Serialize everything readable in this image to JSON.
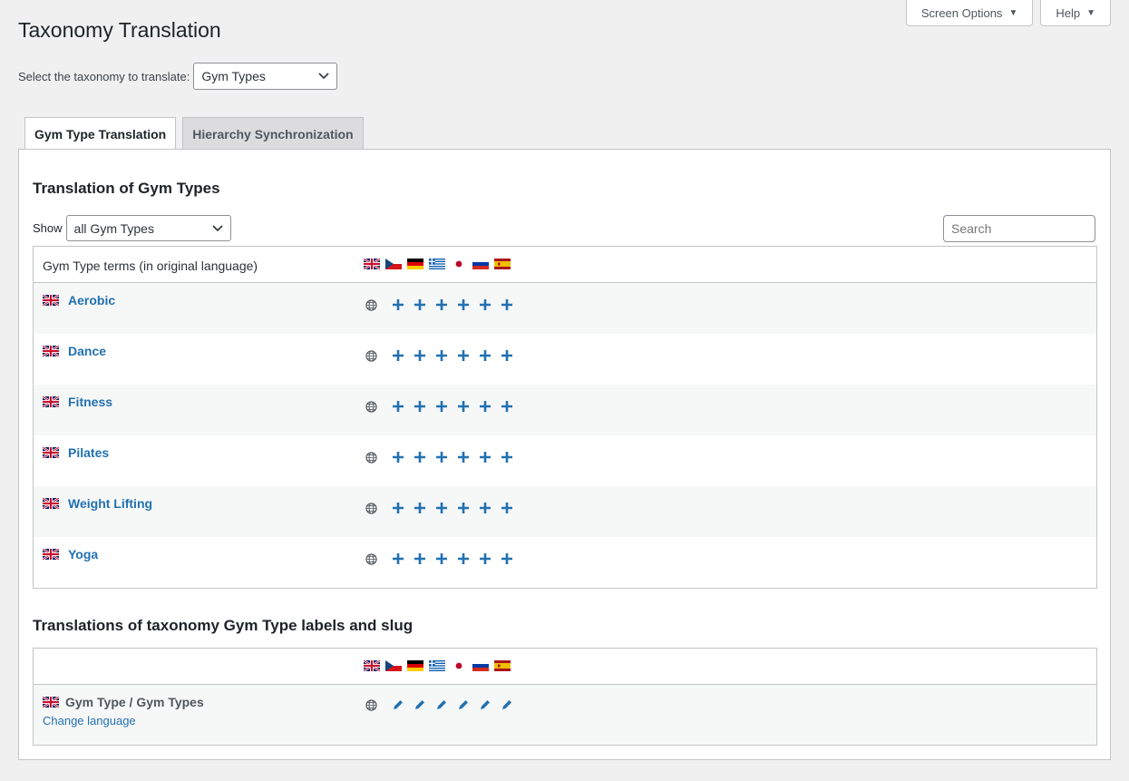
{
  "header": {
    "title": "Taxonomy Translation",
    "screen_options": "Screen Options",
    "help": "Help"
  },
  "taxonomy_select": {
    "label": "Select the taxonomy to translate:",
    "value": "Gym Types"
  },
  "tabs": [
    {
      "label": "Gym Type Translation",
      "active": true
    },
    {
      "label": "Hierarchy Synchronization",
      "active": false
    }
  ],
  "terms_section": {
    "title": "Translation of Gym Types",
    "show_label": "Show",
    "show_value": "all Gym Types",
    "search_placeholder": "Search",
    "column_header": "Gym Type terms (in original language)",
    "languages": [
      "gb-flag-icon",
      "cz-flag-icon",
      "de-flag-icon",
      "gr-flag-icon",
      "jp-flag-icon",
      "ru-flag-icon",
      "es-flag-icon"
    ],
    "terms": [
      {
        "name": "Aerobic"
      },
      {
        "name": "Dance"
      },
      {
        "name": "Fitness"
      },
      {
        "name": "Pilates"
      },
      {
        "name": "Weight Lifting"
      },
      {
        "name": "Yoga"
      }
    ]
  },
  "labels_section": {
    "title": "Translations of taxonomy Gym Type labels and slug",
    "label_text": "Gym Type / Gym Types",
    "change_language": "Change language"
  },
  "colors": {
    "link": "#2271b1",
    "background": "#f0f0f1",
    "border": "#c3c4c7"
  }
}
